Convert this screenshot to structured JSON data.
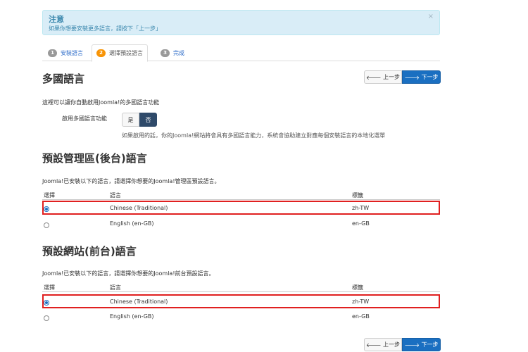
{
  "alert": {
    "title": "注意",
    "text": "如果你想要安裝更多語言，請按下「上一步」",
    "close": "×"
  },
  "tabs": [
    {
      "num": "1",
      "label": "安裝語言"
    },
    {
      "num": "2",
      "label": "選擇預設語言"
    },
    {
      "num": "3",
      "label": "完成"
    }
  ],
  "multilang": {
    "title": "多國語言",
    "desc": "這裡可以讓你自動啟用Joomla!的多國語言功能",
    "toggle_label": "啟用多國語言功能",
    "yes": "是",
    "no": "否",
    "help": "如果啟用的話，你的Joomla!網站將會具有多國語言能力，系統會協助建立對應每個安裝語言的本地化選單"
  },
  "nav": {
    "prev": "上一步",
    "next": "下一步"
  },
  "admin": {
    "title": "預設管理區(後台)語言",
    "desc": "Joomla!已安裝以下的語言，請選擇你想要的Joomla!管理區預設語言。",
    "headers": [
      "選擇",
      "語言",
      "標籤"
    ],
    "rows": [
      {
        "language": "Chinese (Traditional)",
        "tag": "zh-TW",
        "selected": true
      },
      {
        "language": "English (en-GB)",
        "tag": "en-GB",
        "selected": false
      }
    ]
  },
  "site": {
    "title": "預設網站(前台)語言",
    "desc": "Joomla!已安裝以下的語言，請選擇你想要的Joomla!前台預設語言。",
    "headers": [
      "選擇",
      "語言",
      "標籤"
    ],
    "rows": [
      {
        "language": "Chinese (Traditional)",
        "tag": "zh-TW",
        "selected": true
      },
      {
        "language": "English (en-GB)",
        "tag": "en-GB",
        "selected": false
      }
    ]
  },
  "colors": {
    "accent": "#1a6fc1",
    "highlight": "#e02020",
    "alert_bg": "#d9edf7"
  }
}
